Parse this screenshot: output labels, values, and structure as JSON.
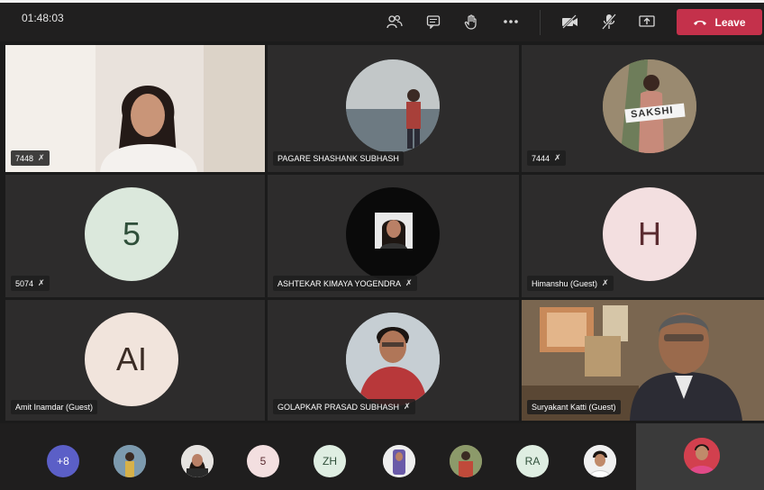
{
  "meeting": {
    "timer": "01:48:03",
    "leave_label": "Leave"
  },
  "toolbar_icons": [
    "participants-icon",
    "chat-icon",
    "raise-hand-icon",
    "more-icon",
    "camera-off-icon",
    "mic-off-icon",
    "share-icon",
    "phone-icon"
  ],
  "tiles": [
    {
      "name": "7448",
      "type": "video"
    },
    {
      "name": "PAGARE SHASHANK SUBHASH",
      "type": "avatar-photo"
    },
    {
      "name": "7444",
      "type": "avatar-photo",
      "photo_text": "SAKSHI"
    },
    {
      "name": "5074",
      "type": "initials",
      "initials": "5",
      "color": "#dbe8dc",
      "text_color": "#2f4f3a"
    },
    {
      "name": "ASHTEKAR KIMAYA YOGENDRA",
      "type": "avatar-photo"
    },
    {
      "name": "Himanshu (Guest)",
      "type": "initials",
      "initials": "H",
      "color": "#f3dfe0",
      "text_color": "#5a2b30"
    },
    {
      "name": "Amit Inamdar (Guest)",
      "type": "initials",
      "initials": "AI",
      "color": "#f1e4dc",
      "text_color": "#3a2b24"
    },
    {
      "name": "GOLAPKAR PRASAD SUBHASH",
      "type": "avatar-photo"
    },
    {
      "name": "Suryakant Katti (Guest)",
      "type": "video"
    }
  ],
  "overflow": {
    "count_label": "+8",
    "items": [
      {
        "label": "",
        "kind": "photo"
      },
      {
        "label": "",
        "kind": "photo"
      },
      {
        "label": "5",
        "kind": "initials",
        "color": "#f3dfe0"
      },
      {
        "label": "ZH",
        "kind": "initials",
        "color": "#dfeee2"
      },
      {
        "label": "",
        "kind": "photo"
      },
      {
        "label": "",
        "kind": "photo"
      },
      {
        "label": "RA",
        "kind": "initials",
        "color": "#dfeee2"
      },
      {
        "label": "",
        "kind": "photo"
      }
    ]
  },
  "colors": {
    "leave": "#c4314b",
    "overflow_badge": "#5b5fc7"
  }
}
